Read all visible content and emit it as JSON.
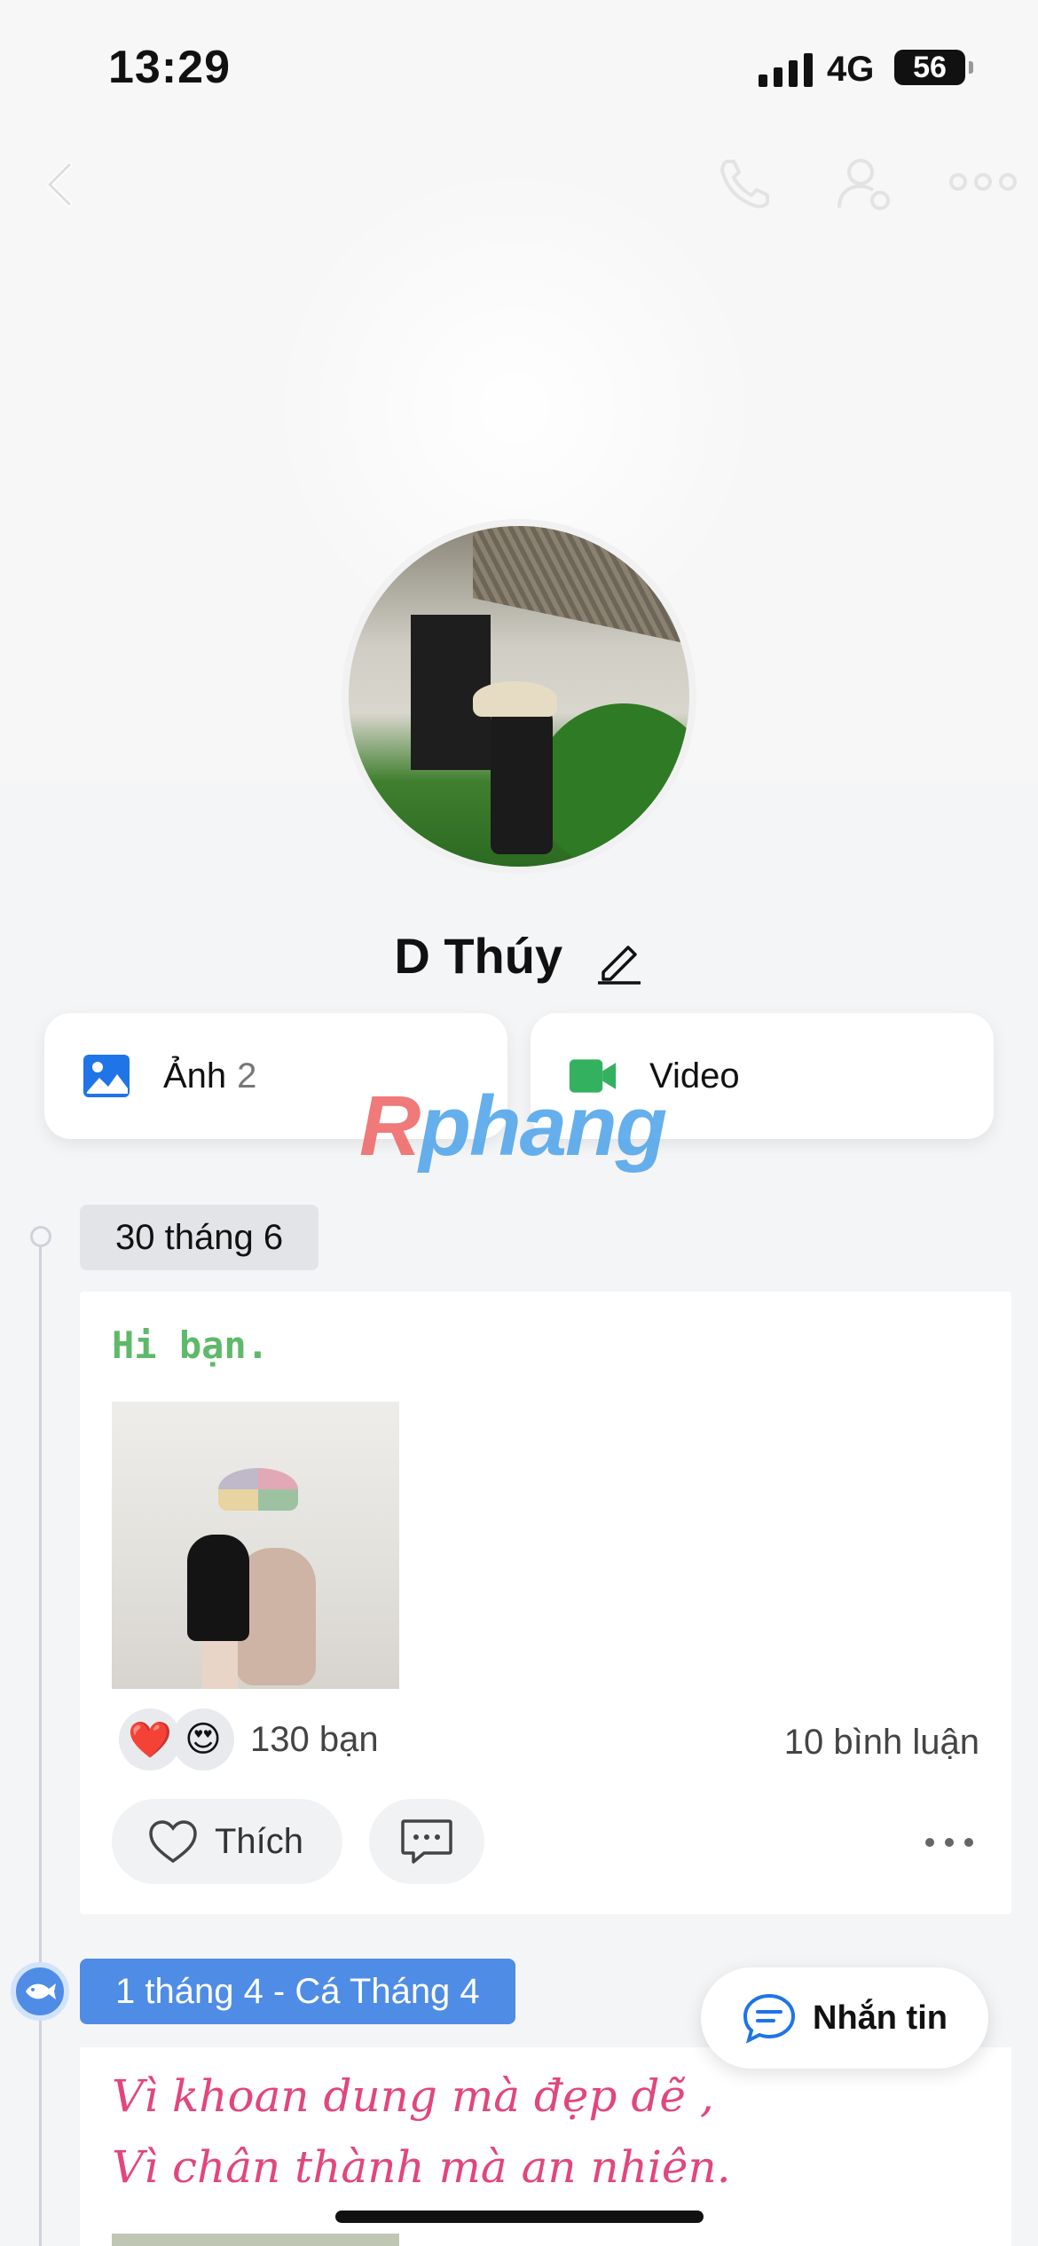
{
  "status_bar": {
    "time": "13:29",
    "network": "4G",
    "battery": "56"
  },
  "header": {
    "back_icon": "chevron-left-icon",
    "call_icon": "phone-icon",
    "profile_settings_icon": "user-gear-icon",
    "more_icon": "more-horizontal-icon"
  },
  "profile": {
    "name": "D Thúy",
    "edit_icon": "pencil-icon"
  },
  "media": {
    "photos_label": "Ảnh",
    "photos_count": "2",
    "videos_label": "Video"
  },
  "watermark": {
    "part1": "R",
    "part2": "phang"
  },
  "timeline": {
    "post1": {
      "date": "30 tháng 6",
      "text": "Hi bạn.",
      "reactions": [
        "❤️",
        "😍"
      ],
      "reaction_count": "130 bạn",
      "comment_count": "10 bình luận",
      "like_label": "Thích"
    },
    "post2": {
      "date": "1 tháng 4 - Cá Tháng 4",
      "line1": "Vì khoan dung mà đẹp dẽ ,",
      "line2": "Vì chân thành mà an nhiên."
    }
  },
  "chat_button": {
    "label": "Nhắn tin"
  },
  "colors": {
    "accent": "#4f8ce6",
    "green_text": "#5fb96a",
    "pink_text": "#e2467a"
  }
}
